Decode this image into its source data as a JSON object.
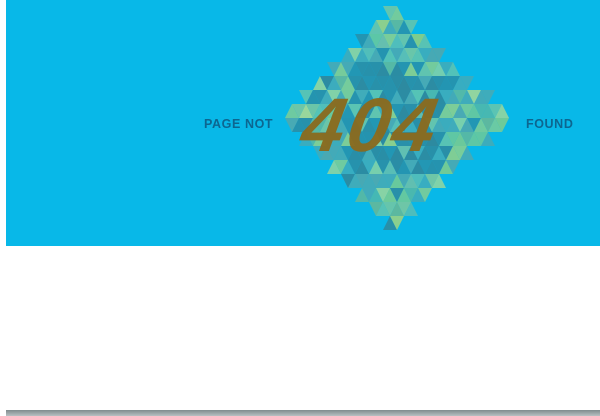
{
  "page": {
    "message_left": "PAGE NOT",
    "error_code": "404",
    "message_right": "FOUND"
  },
  "colors": {
    "background": "#08b8e8",
    "message_text": "#0d6690",
    "digits": "#8a6b1f",
    "mosaic_light": "#8fd08a",
    "mosaic_mid": "#5cb8a0",
    "mosaic_dark": "#2d8aa0"
  }
}
